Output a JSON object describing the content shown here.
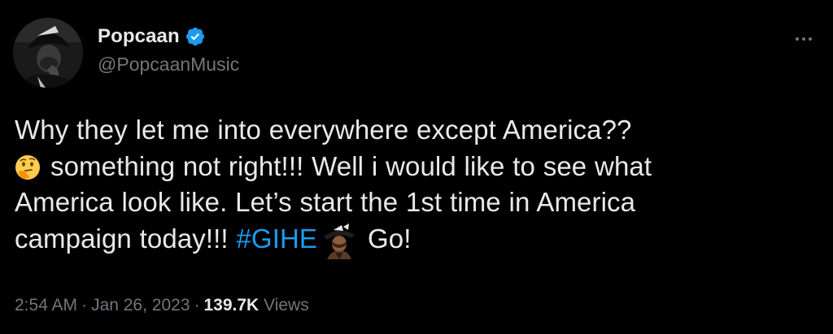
{
  "tweet": {
    "author": {
      "display_name": "Popcaan",
      "handle": "@PopcaanMusic",
      "verified": true,
      "avatar_icon": "avatar-photo",
      "verified_color": "#1d9bf0"
    },
    "more_icon": "more-dots-icon",
    "text": {
      "line1": "Why they let me into everywhere except America??",
      "line2_emoji": "thinking-face-emoji",
      "line2": "something not right!!! Well i would like to see what",
      "line3": "America look like. Let’s start the 1st time in America",
      "line4_pre": "campaign today!!! ",
      "hashtag": "#GIHE",
      "hashtag_emoji": "custom-character-emoji",
      "line4_post": "Go!"
    },
    "meta": {
      "time": "2:54 AM",
      "date": "Jan 26, 2023",
      "views_count": "139.7K",
      "views_label": "Views",
      "separator": "·"
    },
    "colors": {
      "background": "#000000",
      "text": "#e7e9ea",
      "secondary": "#71767b",
      "link": "#1d9bf0"
    }
  }
}
